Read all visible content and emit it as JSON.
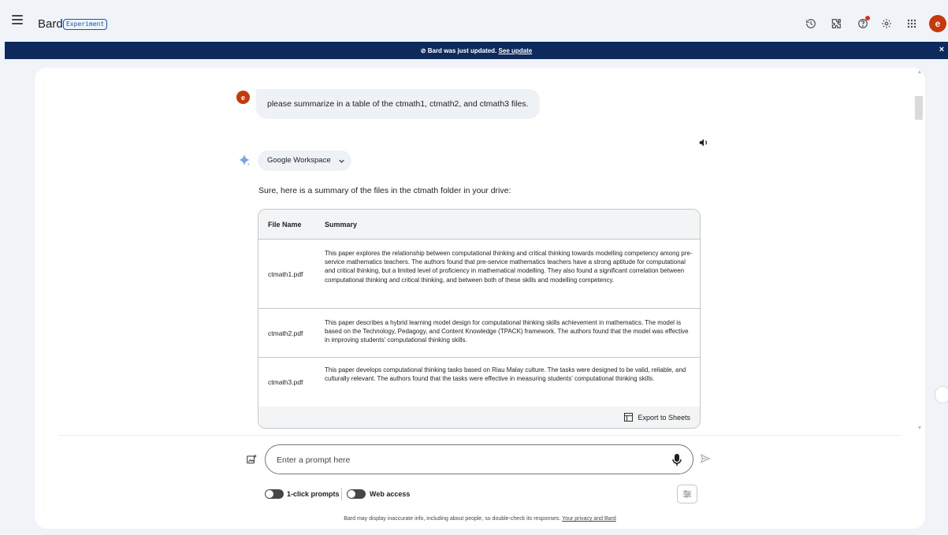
{
  "header": {
    "app_name": "Bard",
    "badge": "Experiment",
    "avatar_letter": "e",
    "icons": [
      "menu-icon",
      "history-icon",
      "extensions-icon",
      "help-icon",
      "settings-icon",
      "apps-icon"
    ],
    "colors": {
      "avatar": "#c5390d",
      "notification_dot": "#d93025",
      "badge": "#0b57d0"
    }
  },
  "banner": {
    "text": "Bard was just updated.",
    "link": "See update",
    "close": "×",
    "color": "#0e2a5c"
  },
  "conversation": {
    "user_avatar_letter": "e",
    "user_message": "please summarize in a table of the ctmath1, ctmath2, and ctmath3 files.",
    "chip_label": "Google Workspace",
    "intro": "Sure, here is a summary of the files in the ctmath folder in your drive:",
    "table": {
      "headers": [
        "File Name",
        "Summary"
      ],
      "rows": [
        {
          "name": "ctmath1.pdf",
          "summary": "This paper explores the relationship between computational thinking and critical thinking towards modelling competency among pre-service mathematics teachers. The authors found that pre-service mathematics teachers have a strong aptitude for computational and critical thinking, but a limited level of proficiency in mathematical modelling. They also found a significant correlation between computational thinking and critical thinking, and between both of these skills and modelling competency."
        },
        {
          "name": "ctmath2.pdf",
          "summary": "This paper describes a hybrid learning model design for computational thinking skills achievement in mathematics. The model is based on the Technology, Pedagogy, and Content Knowledge (TPACK) framework. The authors found that the model was effective in improving students' computational thinking skills."
        },
        {
          "name": "ctmath3.pdf",
          "summary": "This paper develops computational thinking tasks based on Riau Malay culture. The tasks were designed to be valid, reliable, and culturally relevant. The authors found that the tasks were effective in measuring students' computational thinking skills."
        }
      ],
      "export_label": "Export to Sheets"
    }
  },
  "input": {
    "placeholder": "Enter a prompt here",
    "toggle_one_click": "1-click prompts",
    "toggle_web_access": "Web access"
  },
  "footer": {
    "disclaimer": "Bard may display inaccurate info, including about people, so double-check its responses.",
    "privacy_link": "Your privacy and Bard"
  }
}
